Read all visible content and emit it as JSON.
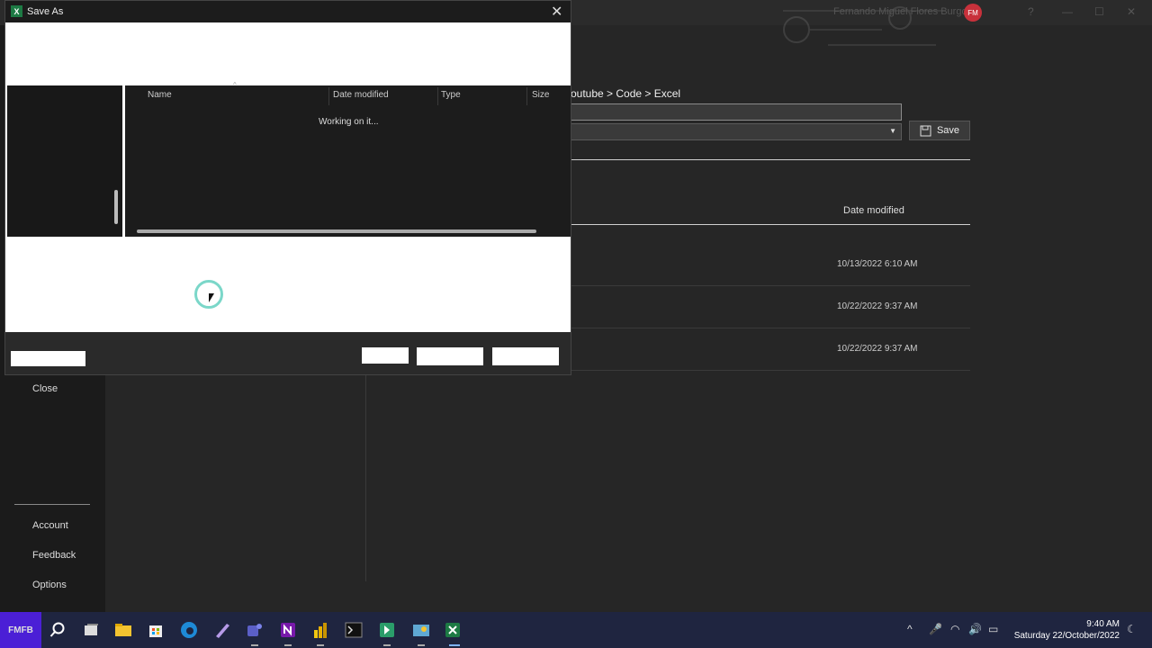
{
  "excel": {
    "user_name": "Fernando Miguel Flores Burgos",
    "avatar_initials": "FM",
    "breadcrumb": "outube > Code > Excel",
    "save_label": "Save",
    "date_modified_header": "Date modified",
    "files": [
      {
        "date": "10/13/2022 6:10 AM"
      },
      {
        "date": "10/22/2022 9:37 AM"
      },
      {
        "date": "10/22/2022 9:37 AM"
      }
    ],
    "nav": {
      "close": "Close",
      "account": "Account",
      "feedback": "Feedback",
      "options": "Options"
    }
  },
  "dialog": {
    "title": "Save As",
    "columns": {
      "name": "Name",
      "date_modified": "Date modified",
      "type": "Type",
      "size": "Size"
    },
    "status": "Working on it..."
  },
  "taskbar": {
    "logo_text": "FMFB",
    "time": "9:40 AM",
    "date": "Saturday 22/October/2022"
  },
  "colors": {
    "excel_green": "#1d7a44",
    "taskbar_bg": "#1f2540",
    "busy_ring": "#7bd7c9"
  }
}
